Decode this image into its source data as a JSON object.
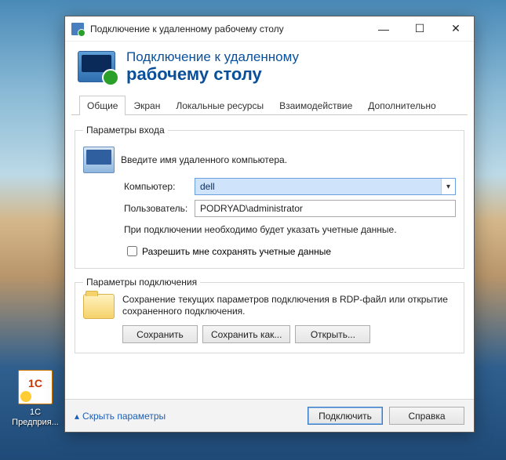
{
  "desktop": {
    "icon_label_line1": "1С",
    "icon_label_line2": "Предприя..."
  },
  "window": {
    "title": "Подключение к удаленному рабочему столу",
    "header_line1": "Подключение к удаленному",
    "header_line2": "рабочему столу"
  },
  "tabs": {
    "general": "Общие",
    "display": "Экран",
    "local": "Локальные ресурсы",
    "experience": "Взаимодействие",
    "advanced": "Дополнительно"
  },
  "login": {
    "legend": "Параметры входа",
    "intro": "Введите имя удаленного компьютера.",
    "computer_label": "Компьютер:",
    "computer_value": "dell",
    "user_label": "Пользователь:",
    "user_value": "PODRYAD\\administrator",
    "note": "При подключении необходимо будет указать учетные данные.",
    "checkbox_label": "Разрешить мне сохранять учетные данные"
  },
  "connection": {
    "legend": "Параметры подключения",
    "text": "Сохранение текущих параметров подключения в RDP-файл или открытие сохраненного подключения.",
    "save": "Сохранить",
    "save_as": "Сохранить как...",
    "open": "Открыть..."
  },
  "footer": {
    "hide": "Скрыть параметры",
    "connect": "Подключить",
    "help": "Справка"
  }
}
